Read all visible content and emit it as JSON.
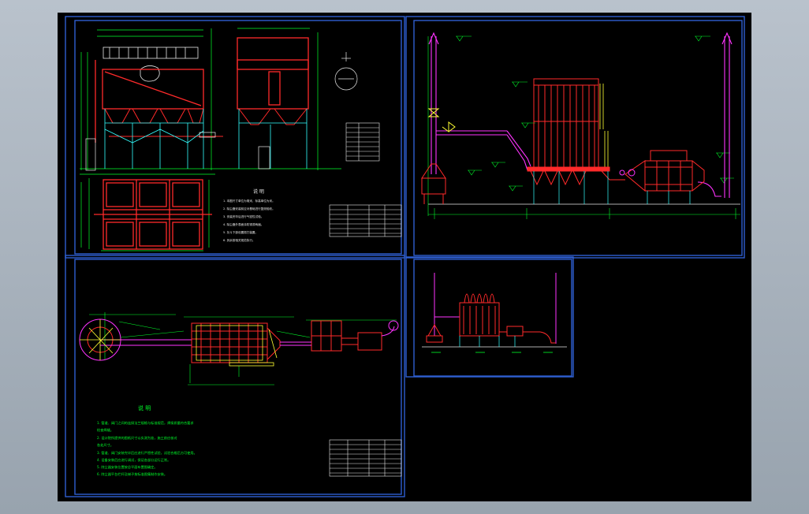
{
  "sheet": {
    "panel_a": {
      "notes_title": "说  明",
      "notes": [
        "1. 本图尺寸单位为毫米，标高单位为米。",
        "2. 除尘器安装前应对基础进行复测验收。",
        "3. 安装完毕后进行气密性试验。",
        "4. 除尘器外表面涂防锈漆两遍。",
        "5. 灰斗下部设置振打装置。",
        "6. 其余按相关规范执行。"
      ]
    },
    "panel_b": {
      "elev_labels": [
        "±0.000",
        "+3.500",
        "+7.200",
        "+12.500",
        "+18.000",
        "+25.000"
      ]
    },
    "panel_c": {
      "notes_title": "说  明",
      "notes": [
        "1. 管道、阀门之间的连接法兰规格与标准规范，焊接质量符合要求",
        "   检查焊缝。",
        "2. 设计院所提供的图纸尺寸以实测为准，施工前应核对",
        "   各处尺寸。",
        "3. 管道、阀门安装完毕后应进行严密性试验，试验合格后方可使用。",
        "4. 设备安装后应进行调试，保证各部分运行正常。",
        "5. 除尘器安装位置按总平面布置图确定。",
        "6. 除尘器平台栏杆及梯子按标准图集制作安装。"
      ]
    },
    "colors": {
      "frame": "#2f5fd0",
      "red": "#ff2a2a",
      "green": "#00ff2a",
      "yellow": "#ffff33",
      "magenta": "#ff33ff",
      "cyan": "#33ffff",
      "white": "#e8e8e8"
    }
  }
}
